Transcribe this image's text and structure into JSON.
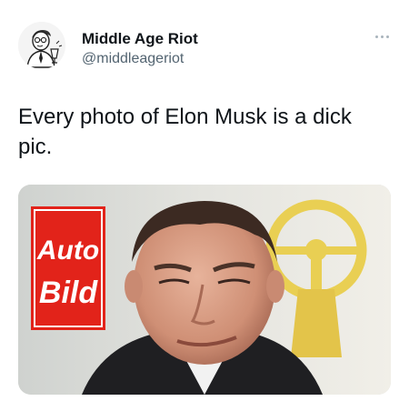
{
  "tweet": {
    "display_name": "Middle Age Riot",
    "handle": "@middleageriot",
    "text": "Every photo of Elon Musk is a dick pic.",
    "more_icon": "more-horizontal-icon",
    "avatar_icon": "cartoon-man-drinking-avatar"
  },
  "media": {
    "logo_line1": "Auto",
    "logo_line2": "Bild",
    "logo_color": "#e2231a",
    "trophy_color": "#e9cf53"
  }
}
